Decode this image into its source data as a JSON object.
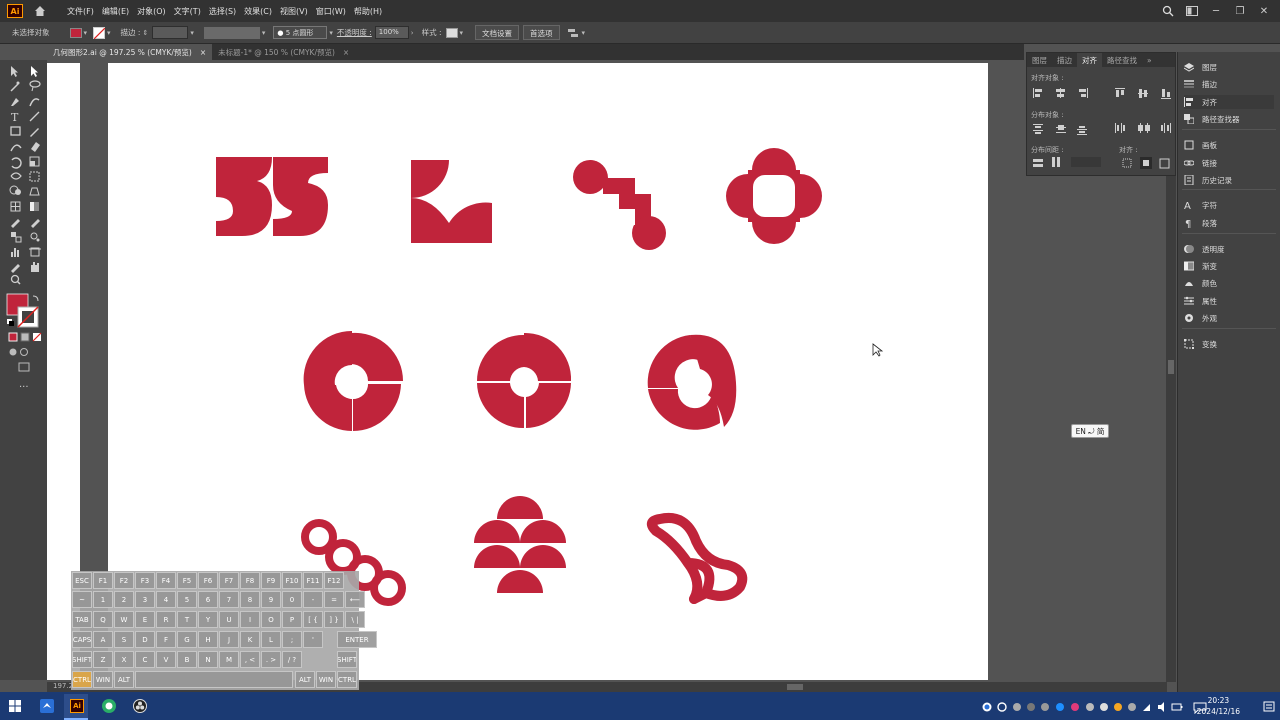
{
  "menubar": {
    "app_badge": "Ai",
    "items": [
      "文件(F)",
      "编辑(E)",
      "对象(O)",
      "文字(T)",
      "选择(S)",
      "效果(C)",
      "视图(V)",
      "窗口(W)",
      "帮助(H)"
    ]
  },
  "controlbar": {
    "no_selection": "未选择对象",
    "stroke_label": "描边 :",
    "brush_label": "5 点圆形",
    "opacity_label": "不透明度 :",
    "opacity_value": "100%",
    "style_label": "样式 :",
    "doc_setup": "文档设置",
    "preferences": "首选项",
    "fill_color": "#c0243b"
  },
  "tabs": [
    {
      "label": "几何图形2.ai @ 197.25 % (CMYK/预览)",
      "close": "×"
    },
    {
      "label": "未标题-1* @ 150 % (CMYK/预览)",
      "close": "×"
    }
  ],
  "status": {
    "zoom": "197.2"
  },
  "align_panel": {
    "tabs": [
      "图层",
      "描边",
      "对齐",
      "路径查找"
    ],
    "active_tab": "对齐",
    "more": "»",
    "sec_align_objects": "对齐对象 :",
    "sec_distribute_objects": "分布对象 :",
    "sec_distribute_spacing": "分布间距 :",
    "sec_align_to": "对齐 :"
  },
  "dock": {
    "items": [
      {
        "label": "图层",
        "icon": "layers-icon"
      },
      {
        "label": "描边",
        "icon": "stroke-icon"
      },
      {
        "label": "对齐",
        "icon": "align-icon"
      },
      {
        "label": "路径查找器",
        "icon": "pathfinder-icon"
      },
      {
        "label": "画板",
        "icon": "artboard-icon"
      },
      {
        "label": "链接",
        "icon": "link-icon"
      },
      {
        "label": "历史记录",
        "icon": "history-icon"
      },
      {
        "label": "字符",
        "icon": "character-icon"
      },
      {
        "label": "段落",
        "icon": "paragraph-icon"
      },
      {
        "label": "透明度",
        "icon": "transparency-icon"
      },
      {
        "label": "渐变",
        "icon": "gradient-icon"
      },
      {
        "label": "颜色",
        "icon": "color-icon"
      },
      {
        "label": "属性",
        "icon": "properties-icon"
      },
      {
        "label": "外观",
        "icon": "appearance-icon"
      },
      {
        "label": "变换",
        "icon": "transform-icon"
      }
    ]
  },
  "ime": {
    "label": "EN ⤾ 简"
  },
  "keyboard": {
    "row1": [
      "ESC",
      "F1",
      "F2",
      "F3",
      "F4",
      "F5",
      "F6",
      "F7",
      "F8",
      "F9",
      "F10",
      "F11",
      "F12"
    ],
    "row2": [
      "~",
      "1",
      "2",
      "3",
      "4",
      "5",
      "6",
      "7",
      "8",
      "9",
      "0",
      "-",
      "=",
      "⟵"
    ],
    "row3": [
      "TAB",
      "Q",
      "W",
      "E",
      "R",
      "T",
      "Y",
      "U",
      "I",
      "O",
      "P",
      "[ {",
      "] }",
      "\\ |"
    ],
    "row4": [
      "CAPS",
      "A",
      "S",
      "D",
      "F",
      "G",
      "H",
      "J",
      "K",
      "L",
      ";",
      "'",
      "ENTER"
    ],
    "row5": [
      "SHIFT",
      "Z",
      "X",
      "C",
      "V",
      "B",
      "N",
      "M",
      ", <",
      ". >",
      "/ ?",
      "SHIFT"
    ],
    "row6": [
      "CTRL",
      "WIN",
      "ALT",
      "ALT",
      "WIN",
      "CTRL"
    ]
  },
  "taskbar": {
    "time": "20:23",
    "date": "2024/12/16"
  },
  "colors": {
    "brand_red": "#c0243b",
    "taskbar": "#1b3a73"
  }
}
